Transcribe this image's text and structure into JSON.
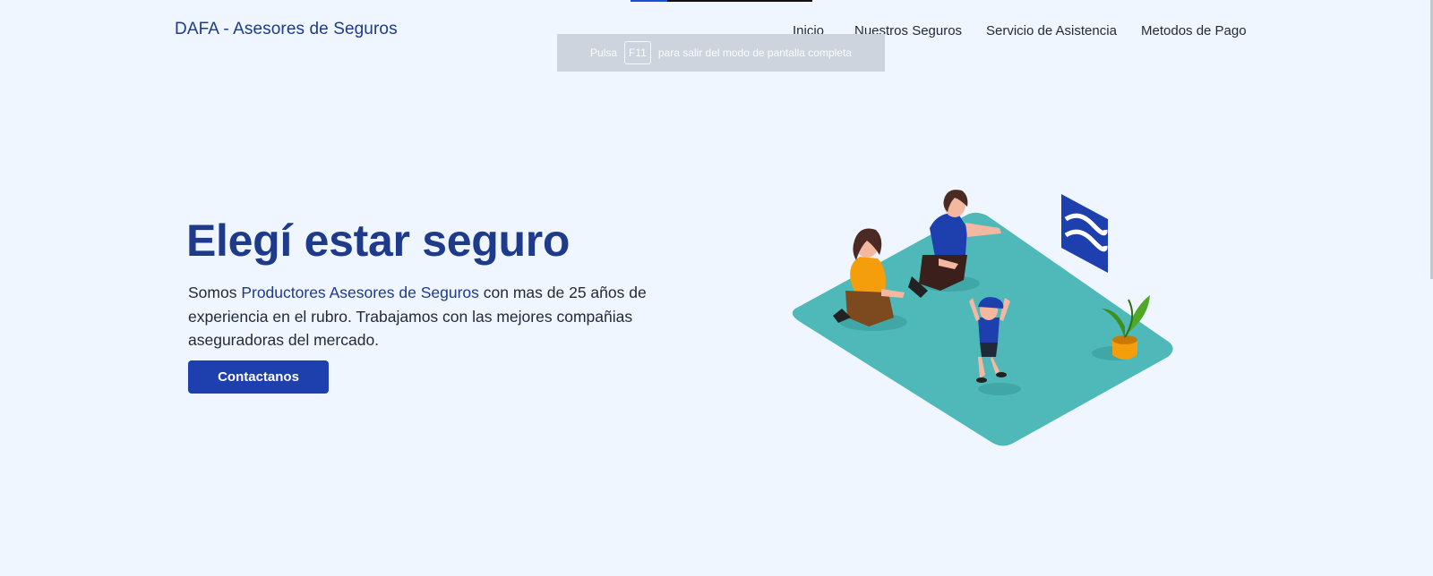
{
  "header": {
    "brand": "DAFA - Asesores de Seguros",
    "nav": [
      "Inicio",
      "Nuestros Seguros",
      "Servicio de Asistencia",
      "Metodos de Pago"
    ]
  },
  "fullscreen_notice": {
    "before": "Pulsa",
    "key": "F11",
    "after": "para salir del modo de pantalla completa"
  },
  "hero": {
    "title": "Elegí estar seguro",
    "text_start": "Somos ",
    "text_highlight": "Productores Asesores de Seguros",
    "text_end": " con mas de 25 años de experiencia en el rubro. Trabajamos con las mejores compañias aseguradoras del mercado.",
    "cta_label": "Contactanos"
  },
  "colors": {
    "background": "#eff6ff",
    "brand": "#1e3a8a",
    "button": "#1e40af",
    "illustration_floor": "#4fb9b9",
    "illustration_sign": "#1e40af"
  },
  "icons": {
    "illustration": "family-insurance-illustration"
  }
}
